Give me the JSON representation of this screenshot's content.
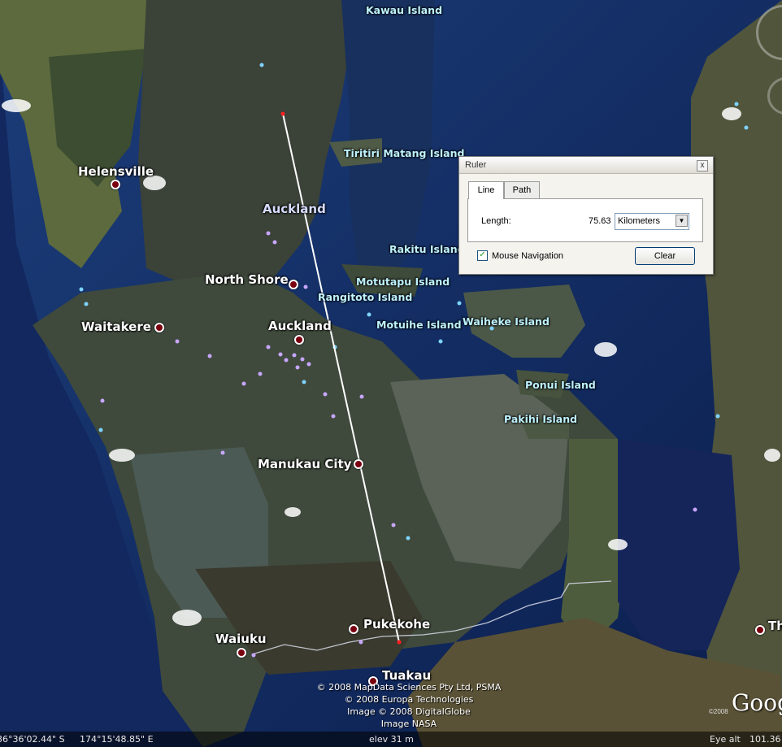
{
  "map": {
    "places": [
      {
        "name": "Kawau Island",
        "kind": "island"
      },
      {
        "name": "Tiritiri Matang Island",
        "kind": "island"
      },
      {
        "name": "Helensville",
        "kind": "town"
      },
      {
        "name": "Auckland",
        "kind": "region"
      },
      {
        "name": "Rakitu Island",
        "kind": "island"
      },
      {
        "name": "North Shore",
        "kind": "town"
      },
      {
        "name": "Motutapu Island",
        "kind": "island"
      },
      {
        "name": "Rangitoto Island",
        "kind": "island"
      },
      {
        "name": "Waitakere",
        "kind": "town"
      },
      {
        "name": "Auckland",
        "kind": "city"
      },
      {
        "name": "Motuihe Island",
        "kind": "island"
      },
      {
        "name": "Waiheke Island",
        "kind": "island"
      },
      {
        "name": "Ponui Island",
        "kind": "island"
      },
      {
        "name": "Pakihi Island",
        "kind": "island"
      },
      {
        "name": "Manukau City",
        "kind": "town"
      },
      {
        "name": "Pukekohe",
        "kind": "town"
      },
      {
        "name": "Waiuku",
        "kind": "town"
      },
      {
        "name": "Tuakau",
        "kind": "town"
      },
      {
        "name": "Th",
        "kind": "town"
      }
    ],
    "credits": [
      "© 2008 MapData Sciences Pty Ltd, PSMA",
      "© 2008 Europa Technologies",
      "Image © 2008 DigitalGlobe",
      "Image NASA"
    ],
    "logo": "Goog",
    "logo_year": "©2008",
    "colors": {
      "ocean": "#0e2456",
      "land": "#4a5546",
      "line": "#ffffff",
      "pin": "#7a0010"
    }
  },
  "status": {
    "latitude": "36°36'02.44\" S",
    "longitude": "174°15'48.85\" E",
    "elevation": "elev   31 m",
    "eye_alt_label": "Eye alt",
    "eye_alt_value": "101.36"
  },
  "ruler": {
    "title": "Ruler",
    "close": "x",
    "tabs": [
      {
        "label": "Line",
        "active": true
      },
      {
        "label": "Path",
        "active": false
      }
    ],
    "length_label": "Length:",
    "length_value": "75.63",
    "unit": "Kilometers",
    "mouse_nav_label": "Mouse Navigation",
    "mouse_nav_checked": true,
    "clear_label": "Clear"
  }
}
